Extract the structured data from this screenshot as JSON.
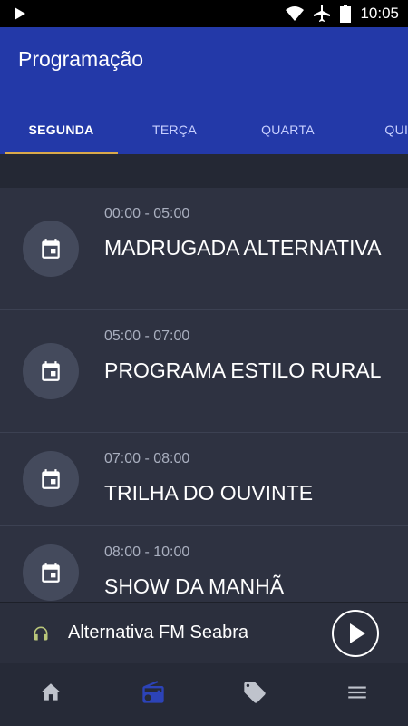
{
  "status_bar": {
    "time": "10:05"
  },
  "app_bar": {
    "title": "Programação"
  },
  "tabs": [
    {
      "label": "SEGUNDA",
      "active": true
    },
    {
      "label": "TERÇA",
      "active": false
    },
    {
      "label": "QUARTA",
      "active": false
    },
    {
      "label": "QUIN",
      "active": false
    }
  ],
  "programs": [
    {
      "time": "00:00 - 05:00",
      "name": "MADRUGADA ALTERNATIVA"
    },
    {
      "time": "05:00 - 07:00",
      "name": "PROGRAMA ESTILO RURAL"
    },
    {
      "time": "07:00 - 08:00",
      "name": "TRILHA DO OUVINTE"
    },
    {
      "time": "08:00 - 10:00",
      "name": "SHOW DA MANHÃ"
    }
  ],
  "player": {
    "station": "Alternativa FM Seabra"
  },
  "bottom_nav": [
    {
      "icon": "home-icon",
      "active": false
    },
    {
      "icon": "radio-icon",
      "active": true
    },
    {
      "icon": "tag-icon",
      "active": false
    },
    {
      "icon": "menu-icon",
      "active": false
    }
  ],
  "colors": {
    "app_bar": "#2339a8",
    "tab_indicator": "#d9a94b",
    "active_nav": "#2c43b8",
    "background": "#2e3241"
  }
}
